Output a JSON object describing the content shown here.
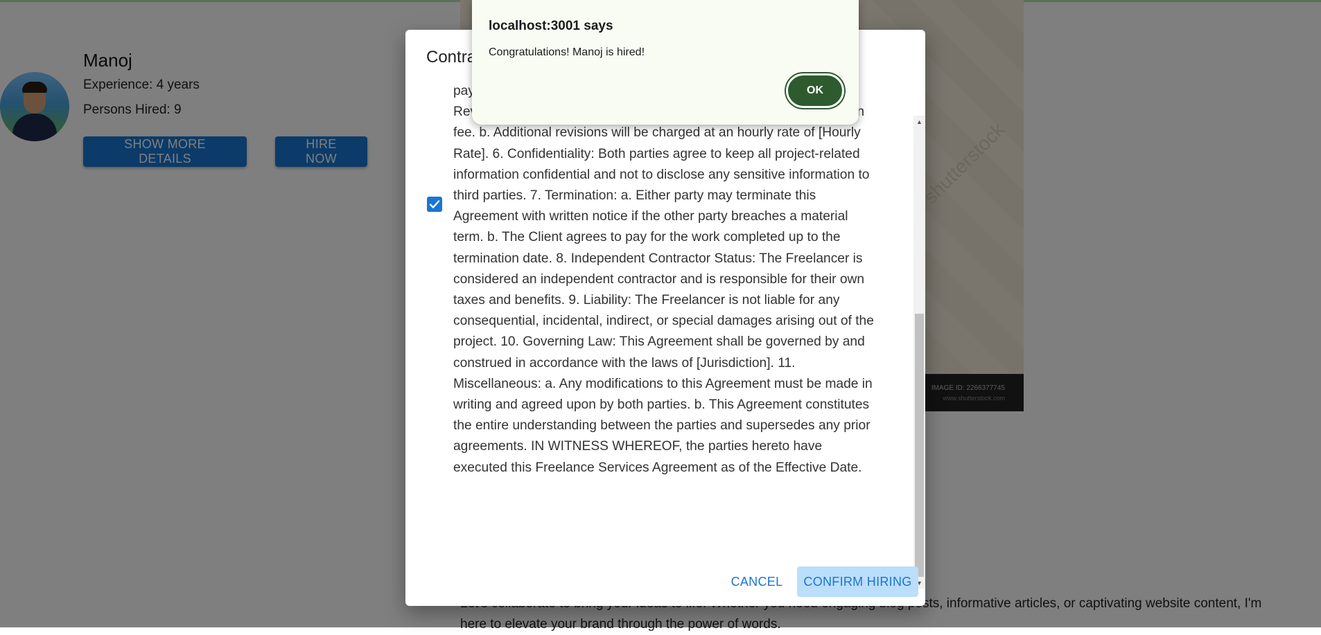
{
  "profile": {
    "name": "Manoj",
    "experience": "Experience: 4 years",
    "persons_hired": "Persons Hired: 9",
    "show_more_label": "SHOW MORE DETAILS",
    "hire_now_label": "HIRE NOW"
  },
  "stock_image": {
    "watermark": "shutterstock",
    "image_id": "IMAGE ID: 2266377745",
    "url": "www.shutterstock.com"
  },
  "background_text": {
    "tagline": "Let's collaborate to bring your ideas to life! Whether you need engaging blog posts, informative articles, or captivating website content, I'm here to elevate your brand through the power of words."
  },
  "dialog": {
    "title": "Contract",
    "checkbox_checked": true,
    "agreement_text": "payment will be made upon completion and delivery of the project. 5. Revisions: a. A maximum of revisions are included in the agreed-upon fee. b. Additional revisions will be charged at an hourly rate of [Hourly Rate]. 6. Confidentiality: Both parties agree to keep all project-related information confidential and not to disclose any sensitive information to third parties. 7. Termination: a. Either party may terminate this Agreement with written notice if the other party breaches a material term. b. The Client agrees to pay for the work completed up to the termination date. 8. Independent Contractor Status: The Freelancer is considered an independent contractor and is responsible for their own taxes and benefits. 9. Liability: The Freelancer is not liable for any consequential, incidental, indirect, or special damages arising out of the project. 10. Governing Law: This Agreement shall be governed by and construed in accordance with the laws of [Jurisdiction]. 11. Miscellaneous: a. Any modifications to this Agreement must be made in writing and agreed upon by both parties. b. This Agreement constitutes the entire understanding between the parties and supersedes any prior agreements. IN WITNESS WHEREOF, the parties hereto have executed this Freelance Services Agreement as of the Effective Date.",
    "cancel_label": "CANCEL",
    "confirm_label": "CONFIRM HIRING"
  },
  "alert": {
    "title": "localhost:3001 says",
    "message": "Congratulations! Manoj is hired!",
    "ok_label": "OK"
  },
  "colors": {
    "primary": "#1976d2",
    "confirm_bg_disabled": "#bbdefb",
    "alert_bg": "#f9fcf2",
    "alert_ok": "#2e5b2e"
  }
}
